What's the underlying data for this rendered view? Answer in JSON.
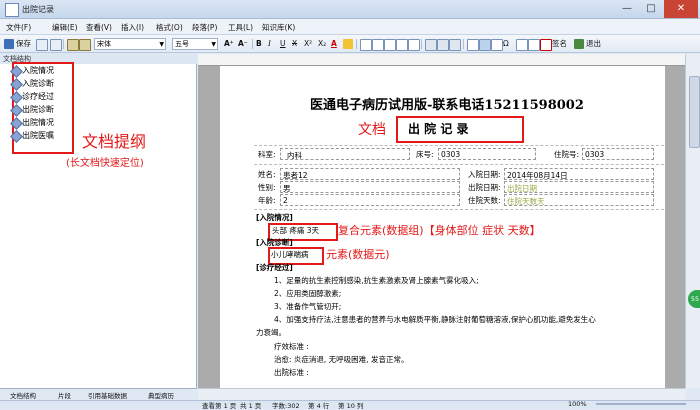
{
  "window": {
    "title": "出院记录",
    "minimize": "—",
    "maximize": "□",
    "close": "✕"
  },
  "menu": [
    "文件(F)",
    "编辑(E)",
    "查看(V)",
    "插入(I)",
    "格式(O)",
    "段落(P)",
    "工具(L)",
    "知识库(K)"
  ],
  "toolbar": {
    "save": "保存",
    "font": "宋体",
    "size": "五号",
    "bold": "B",
    "italic": "I",
    "underline": "U",
    "strike": "X",
    "sup": "X²",
    "sub": "X₂",
    "sign": "签名",
    "exit": "退出",
    "grow": "A⁺",
    "shrink": "A⁻",
    "fontcolor": "A",
    "omega": "Ω"
  },
  "left_panel": {
    "header": "文档结构",
    "items": [
      "入院情况",
      "入院诊断",
      "诊疗经过",
      "出院诊断",
      "出院情况",
      "出院医嘱"
    ],
    "annotation_title": "文档提纲",
    "annotation_sub": "(长文档快速定位)",
    "tabs": [
      "文档结构",
      "片段",
      "引用基础数据",
      "典型病历"
    ]
  },
  "document": {
    "hospital_title": "医通电子病历试用版-联系电话15211598002",
    "doc_label": "文档",
    "record_title": "出 院 记 录",
    "dept_label": "科室:",
    "dept": "内科",
    "bed_label": "床号:",
    "bed": "0303",
    "inpatient_label": "住院号:",
    "inpatient": "0303",
    "name_label": "姓名:",
    "name": "患者12",
    "sex_label": "性别:",
    "sex": "男",
    "age_label": "年龄:",
    "age": "2",
    "admit_label": "入院日期:",
    "admit": "2014年08月14日",
    "discharge_label": "出院日期:",
    "discharge": "出院日期",
    "stay_label": "住院天数:",
    "stay": "住院天数天",
    "sec1": "[入院情况]",
    "complex_value": "头部 疼痛 3天",
    "complex_annot": "复合元素(数据组)【身体部位 症状 天数】",
    "sec2": "[入院诊断]",
    "element_value": "小儿哮喘病",
    "element_annot": "元素(数据元)",
    "sec3": "[诊疗经过]",
    "lines": [
      "1、足量的抗生素控制感染,抗生素激素及肾上腺素气雾化吸入;",
      "2、应用类固醇激素;",
      "3、准备作气管切开;",
      "4、加强支持疗法,注意患者的营养与水电解质平衡,静脉注射葡萄糖溶液,保护心肌功能,避免发生心",
      "力衰竭。"
    ],
    "effect_label": "疗效标准 :",
    "treat_line": "治愈: 炎症消退, 无呼吸困难, 发音正常。",
    "discharge_std": "出院标准 :"
  },
  "status": {
    "page": "查看第 1 页",
    "of": "共 1 页",
    "chars": "字数:302",
    "row": "第 4 行",
    "col": "第 10 列",
    "zoom": "100%"
  },
  "badge": "55",
  "colors": {
    "annotation": "#e31818",
    "accent": "#2fa84f",
    "titlebar": "#c5d6ec"
  }
}
